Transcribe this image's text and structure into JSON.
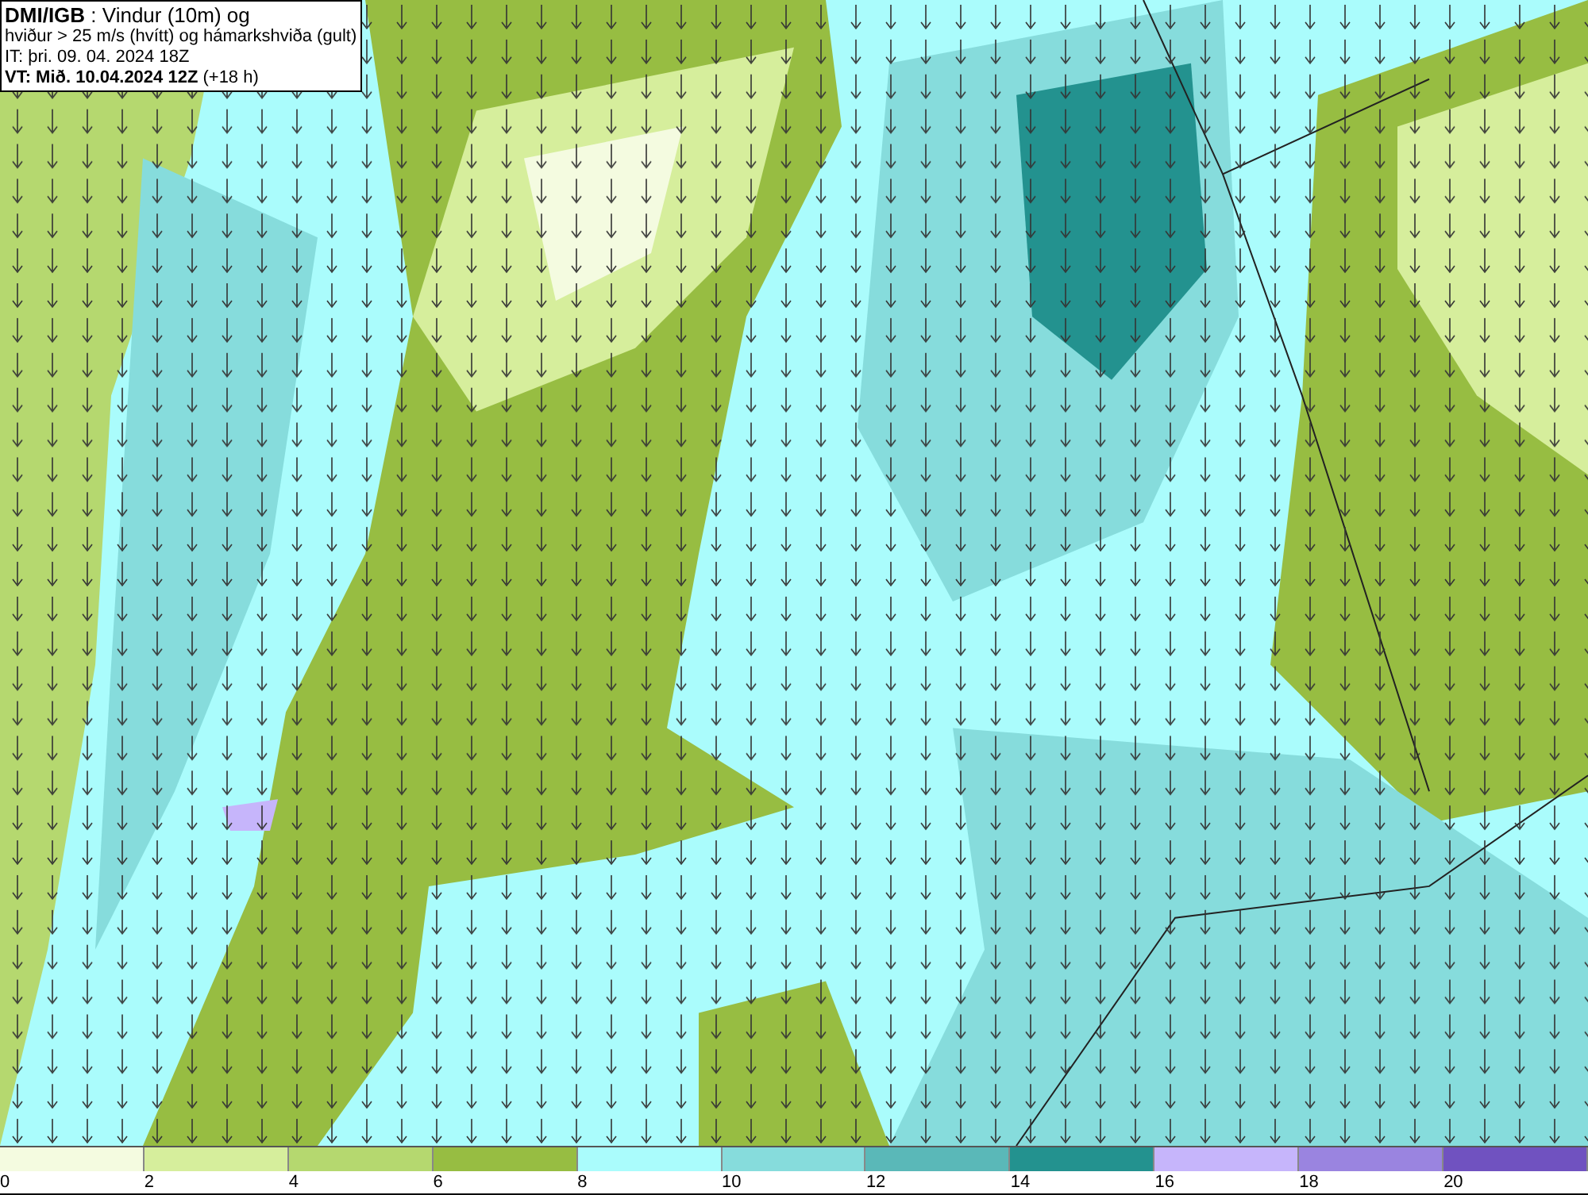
{
  "header": {
    "lines": [
      "**DMI/IGB** : Vindur (10m) og",
      "hviður > 25 m/s (hvítt) og hámarkshviða (gult)",
      "IT: þri. 09. 04. 2024 18Z",
      "**VT: Mið. 10.04.2024 12Z** (+18 h)"
    ]
  },
  "legend": {
    "segments": [
      {
        "color": "#f4fbe0"
      },
      {
        "color": "#d6ee9c"
      },
      {
        "color": "#b5d86f"
      },
      {
        "color": "#97bd42"
      },
      {
        "color": "#aafcfc"
      },
      {
        "color": "#86dcdc"
      },
      {
        "color": "#5ab8b8"
      },
      {
        "color": "#23928f"
      },
      {
        "color": "#c6b5fb"
      },
      {
        "color": "#9a84e0"
      },
      {
        "color": "#7052c0"
      }
    ],
    "ticks": [
      "0",
      "2",
      "4",
      "6",
      "8",
      "10",
      "12",
      "14",
      "16",
      "18",
      "20"
    ]
  }
}
